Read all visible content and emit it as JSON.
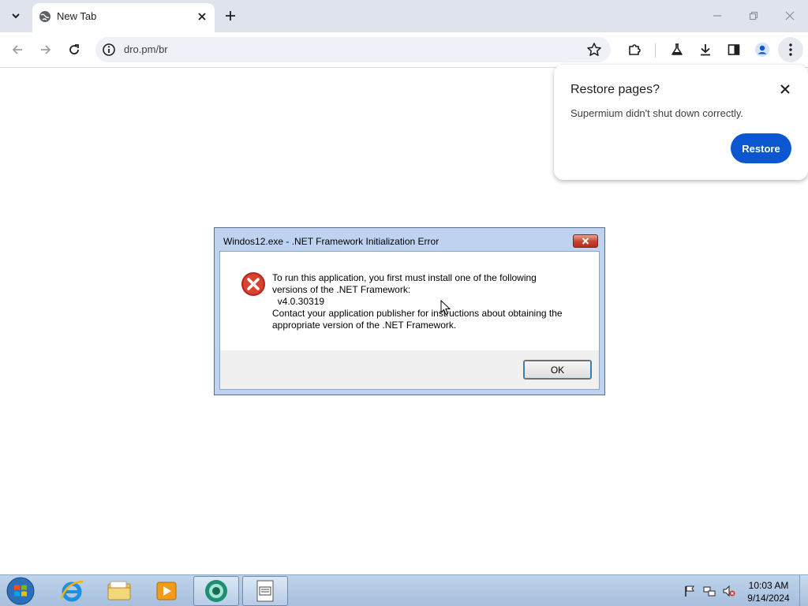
{
  "browser": {
    "tab": {
      "title": "New Tab"
    },
    "address": {
      "url": "dro.pm/br"
    }
  },
  "restore_popup": {
    "title": "Restore pages?",
    "message": "Supermium didn't shut down correctly.",
    "button_label": "Restore"
  },
  "error_dialog": {
    "title": "Windos12.exe - .NET Framework Initialization Error",
    "lines": [
      "To run this application, you first must install one of the following",
      "versions of the .NET Framework:",
      "  v4.0.30319",
      "Contact your application publisher for instructions about obtaining the",
      "appropriate version of the .NET Framework."
    ],
    "ok_label": "OK"
  },
  "taskbar": {
    "items": [
      "start",
      "internet-explorer",
      "windows-explorer",
      "media-player",
      "supermium-browser",
      "application-window"
    ],
    "clock": {
      "time": "10:03 AM",
      "date": "9/14/2024"
    }
  },
  "colors": {
    "accent": "#0b57d0",
    "tabstrip": "#dfe3eb",
    "dialog_frame": "#bdd3ef",
    "close_red": "#c7432e"
  }
}
